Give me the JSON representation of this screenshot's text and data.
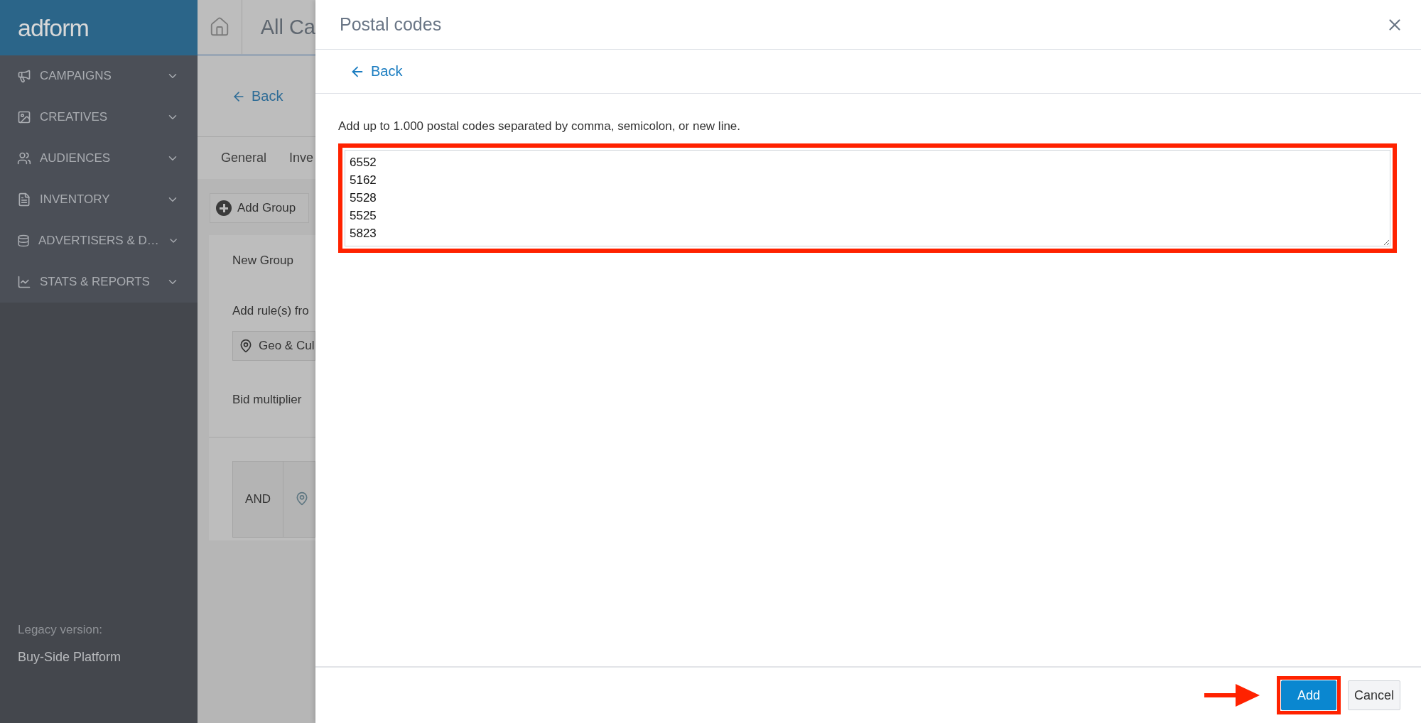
{
  "sidebar": {
    "logo": "adform",
    "items": [
      {
        "label": "CAMPAIGNS"
      },
      {
        "label": "CREATIVES"
      },
      {
        "label": "AUDIENCES"
      },
      {
        "label": "INVENTORY"
      },
      {
        "label": "ADVERTISERS & D…"
      },
      {
        "label": "STATS & REPORTS"
      }
    ],
    "legacy_label": "Legacy version:",
    "legacy_link": "Buy-Side Platform"
  },
  "background_page": {
    "title": "All Ca",
    "back": "Back",
    "tabs": [
      "General",
      "Inve"
    ],
    "add_group": "Add Group",
    "group": {
      "name": "New Group",
      "rules_label": "Add rule(s) fro",
      "rule_button": "Geo & Cul",
      "bid_label": "Bid multiplier",
      "operator": "AND"
    }
  },
  "modal": {
    "title": "Postal codes",
    "back": "Back",
    "hint": "Add up to 1.000 postal codes separated by comma, semicolon, or new line.",
    "codes": [
      "6552",
      "5162",
      "5528",
      "5525",
      "5823"
    ],
    "codes_highlighted": true,
    "buttons": [
      {
        "label": "Add",
        "kind": "primary",
        "highlighted": true
      },
      {
        "label": "Cancel",
        "kind": "secondary",
        "highlighted": false
      }
    ]
  }
}
